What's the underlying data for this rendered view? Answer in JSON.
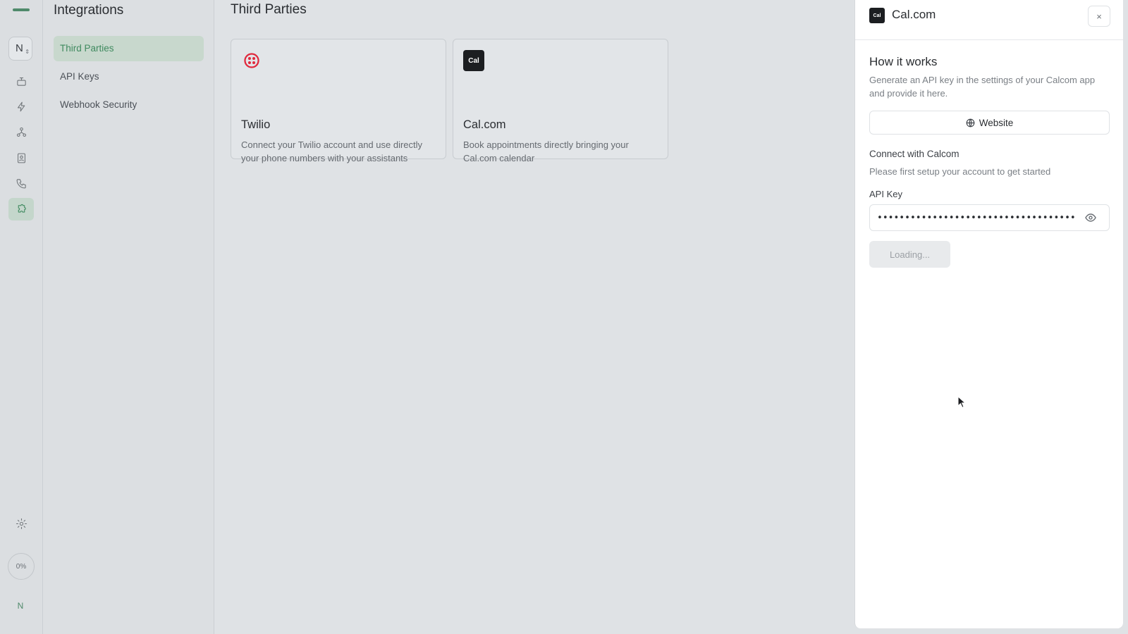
{
  "rail": {
    "workspace_initial": "N",
    "items": [
      {
        "name": "robot-icon"
      },
      {
        "name": "lightning-icon"
      },
      {
        "name": "network-icon"
      },
      {
        "name": "contact-icon"
      },
      {
        "name": "phone-icon"
      },
      {
        "name": "puzzle-icon",
        "active": true
      }
    ],
    "usage_label": "0%",
    "user_initial": "N",
    "accent": "#3f8a5f"
  },
  "sidebar": {
    "title": "Integrations",
    "items": [
      {
        "label": "Third Parties",
        "active": true
      },
      {
        "label": "API Keys"
      },
      {
        "label": "Webhook Security"
      }
    ]
  },
  "main": {
    "title": "Third Parties",
    "cards": [
      {
        "name": "Twilio",
        "description": "Connect your Twilio account and use directly your phone numbers with your assistants",
        "icon": "twilio-icon",
        "icon_color": "#e0283c"
      },
      {
        "name": "Cal.com",
        "description": "Book appointments directly bringing your Cal.com calendar",
        "icon": "calcom-icon",
        "icon_text": "Cal"
      }
    ]
  },
  "panel": {
    "logo_text": "Cal",
    "title": "Cal.com",
    "close_label": "×",
    "how_title": "How it works",
    "how_description": "Generate an API key in the settings of your Calcom app and provide it here.",
    "website_label": "Website",
    "connect_title": "Connect with Calcom",
    "connect_subtitle": "Please first setup your account to get started",
    "api_key_label": "API Key",
    "api_key_value": "••••••••••••••••••••••••••••••••••••",
    "loading_label": "Loading..."
  }
}
